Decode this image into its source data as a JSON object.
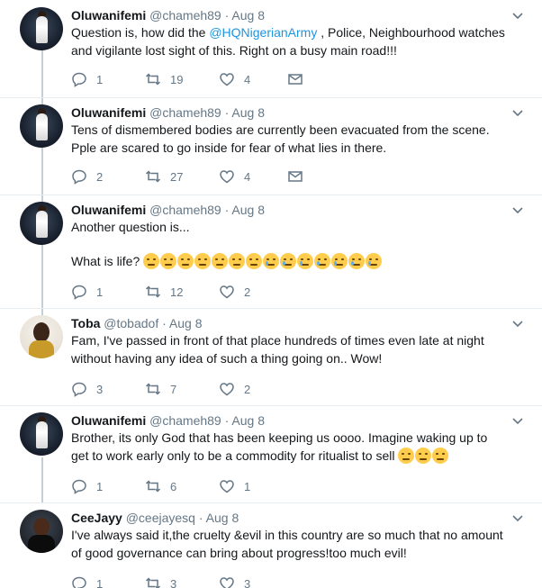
{
  "tweets": [
    {
      "name": "Oluwanifemi",
      "handle": "@chameh89",
      "date": "Aug 8",
      "line1_pre": "Question is, how did the ",
      "mention": "@HQNigerianArmy",
      "line1_post": " , Police, Neighbourhood watches",
      "line2": "and vigilante lost sight of this. Right on a busy main road!!!",
      "replies": "1",
      "retweets": "19",
      "likes": "4"
    },
    {
      "name": "Oluwanifemi",
      "handle": "@chameh89",
      "date": "Aug 8",
      "line1": "Tens of dismembered bodies are currently been evacuated from the scene.",
      "line2": "Pple are scared to go inside for fear of what lies in there.",
      "replies": "2",
      "retweets": "27",
      "likes": "4"
    },
    {
      "name": "Oluwanifemi",
      "handle": "@chameh89",
      "date": "Aug 8",
      "line1": "Another question is...",
      "line2": "What is life?",
      "replies": "1",
      "retweets": "12",
      "likes": "2"
    },
    {
      "name": "Toba",
      "handle": "@tobadof",
      "date": "Aug 8",
      "line1": "Fam, I've passed in front of that place hundreds of times even late at night",
      "line2": "without having any idea of such a thing going on.. Wow!",
      "replies": "3",
      "retweets": "7",
      "likes": "2"
    },
    {
      "name": "Oluwanifemi",
      "handle": "@chameh89",
      "date": "Aug 8",
      "line1": "Brother, its only God that has been keeping us oooo. Imagine waking up to",
      "line2": "get to work early only to be a commodity for ritualist to sell",
      "replies": "1",
      "retweets": "6",
      "likes": "1"
    },
    {
      "name": "CeeJayy",
      "handle": "@ceejayesq",
      "date": "Aug 8",
      "line1": "I've always said it,the cruelty &evil in this country are so much that no amount",
      "line2": "of good governance can bring about progress!too much evil!",
      "replies": "1",
      "retweets": "3",
      "likes": "3"
    }
  ],
  "separator": "·",
  "icons": {
    "reply": "reply-icon",
    "retweet": "retweet-icon",
    "like": "heart-icon",
    "dm": "envelope-icon",
    "more": "chevron-down-icon"
  },
  "emoji_sets": {
    "tweet3": [
      "disappointed-face",
      "disappointed-face",
      "disappointed-face",
      "disappointed-face",
      "disappointed-face",
      "disappointed-face",
      "disappointed-face",
      "crying-face",
      "crying-face",
      "crying-face",
      "crying-face",
      "crying-face",
      "crying-face",
      "crying-face"
    ],
    "tweet5": [
      "hushed-face",
      "hushed-face",
      "hushed-face"
    ]
  },
  "colors": {
    "link": "#1b95e0",
    "secondary": "#657786",
    "text": "#14171a",
    "thread": "#c4cfd6"
  }
}
